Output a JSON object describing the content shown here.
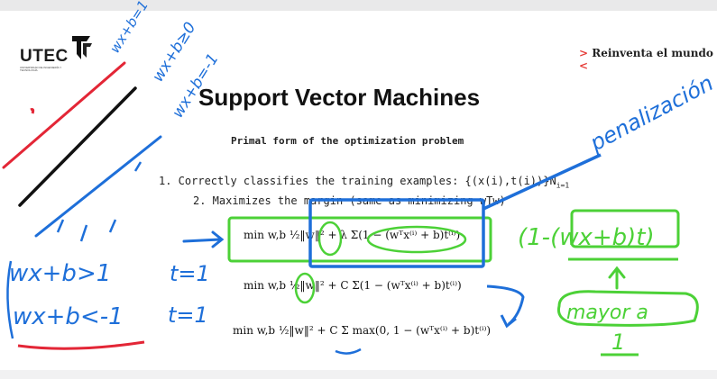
{
  "header": {
    "logo_text": "UTEC",
    "logo_subtext": "UNIVERSIDAD DE INGENIERÍA Y TECNOLOGÍA",
    "tagline_prefix": ">",
    "tagline": "Reinventa el mundo",
    "tagline_suffix": "<"
  },
  "slide": {
    "title": "Support Vector Machines",
    "subtitle": "Primal form of the optimization problem",
    "items": [
      "1. Correctly classifies the training examples: {(x(i),t(i))}N",
      "2. Maximizes the margin (same as minimizing wTw)"
    ],
    "item1_sub": "i=1"
  },
  "formulas": {
    "f1": "min w,b  ½‖w‖² + λ Σ(1 − (wᵀx⁽ⁱ⁾ + b)t⁽ⁱ⁾)",
    "f2": "min w,b  ½‖w‖² + C Σ(1 − (wᵀx⁽ⁱ⁾ + b)t⁽ⁱ⁾)",
    "f3": "min w,b  ½‖w‖² + C Σ max(0, 1 − (wᵀx⁽ⁱ⁾ + b)t⁽ⁱ⁾)"
  },
  "annotations": {
    "line_top": "wx+b=1",
    "line_mid": "wx+b≥0",
    "line_bot": "wx+b=-1",
    "ineq_1": "wx+b>1",
    "t_1": "t=1",
    "ineq_2": "wx+b<-1",
    "t_2": "t=1",
    "penalizacion": "penalización",
    "loss_term": "(1-(wx+b)t)",
    "mayor_a": "mayor a",
    "one": "1",
    "colors": {
      "blue": "#1e6fd9",
      "green": "#4cd137",
      "red": "#e32636",
      "black": "#111111"
    }
  }
}
